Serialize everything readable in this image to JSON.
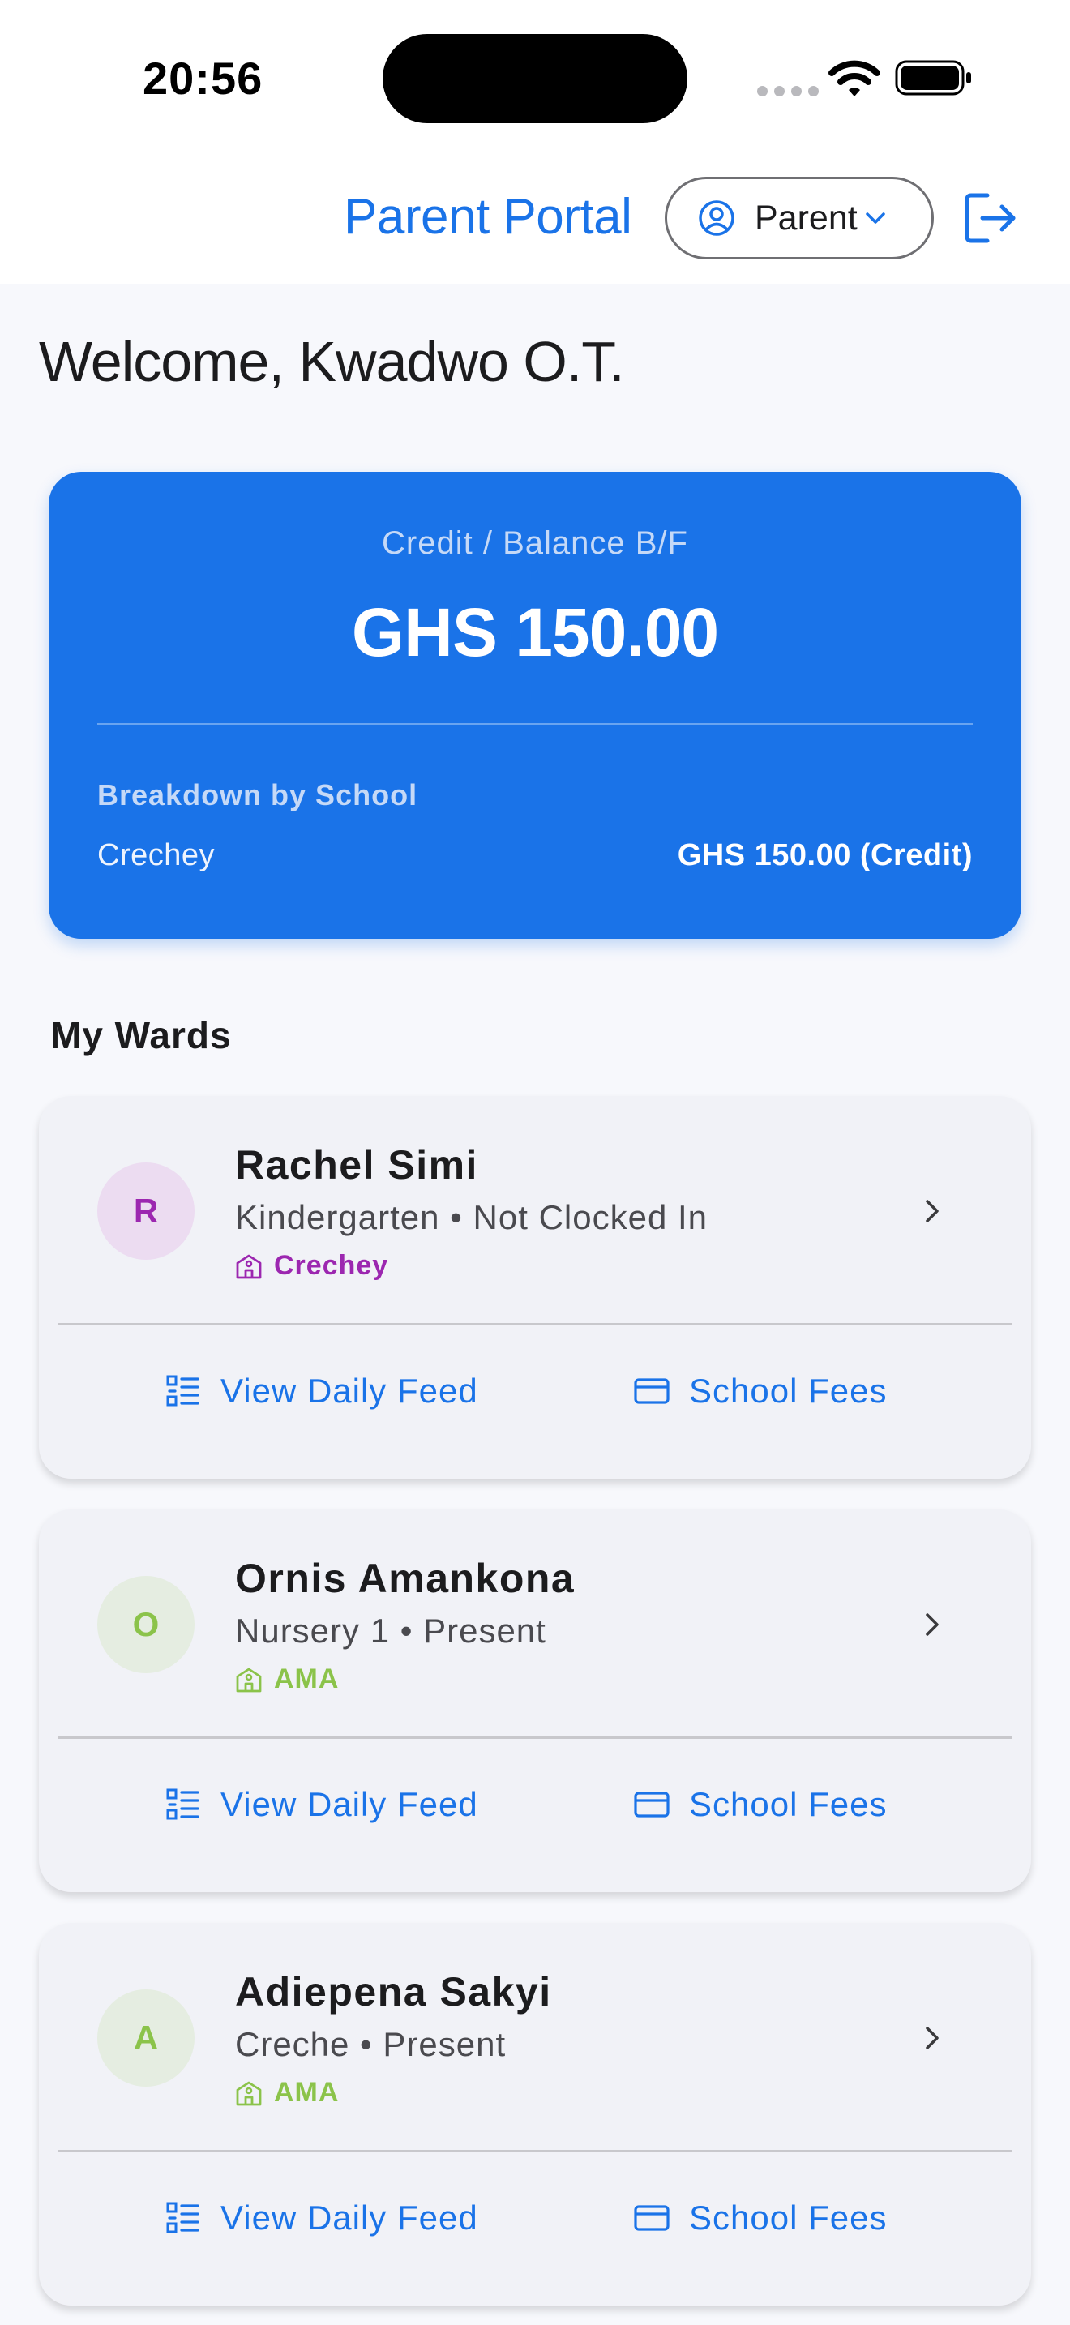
{
  "status_bar": {
    "time": "20:56"
  },
  "header": {
    "title": "Parent Portal",
    "role_label": "Parent"
  },
  "welcome": "Welcome, Kwadwo O.T.",
  "balance": {
    "label": "Credit / Balance B/F",
    "amount": "GHS 150.00",
    "breakdown_title": "Breakdown by School",
    "breakdown": [
      {
        "school": "Crechey",
        "amount": "GHS 150.00 (Credit)"
      }
    ]
  },
  "wards_section": {
    "title": "My Wards"
  },
  "wards": [
    {
      "initial": "R",
      "name": "Rachel Simi",
      "subtitle": "Kindergarten • Not Clocked In",
      "school": "Crechey",
      "accent": "#9c27b0",
      "avatar_bg": "#ecdcf1",
      "feed_label": "View Daily Feed",
      "fees_label": "School Fees"
    },
    {
      "initial": "O",
      "name": "Ornis Amankona",
      "subtitle": "Nursery 1 • Present",
      "school": "AMA",
      "accent": "#8bc34a",
      "avatar_bg": "#e5ede1",
      "feed_label": "View Daily Feed",
      "fees_label": "School Fees"
    },
    {
      "initial": "A",
      "name": "Adiepena Sakyi",
      "subtitle": "Creche • Present",
      "school": "AMA",
      "accent": "#8bc34a",
      "avatar_bg": "#e5ede1",
      "feed_label": "View Daily Feed",
      "fees_label": "School Fees"
    }
  ],
  "icons": {
    "role": "user-circle-icon",
    "dropdown": "chevron-down-icon",
    "logout": "logout-icon",
    "school": "school-building-icon",
    "ward_open": "chevron-right-icon",
    "feed": "list-icon",
    "fees": "credit-card-icon"
  },
  "colors": {
    "primary": "#1a73e8",
    "background": "#f7f8fc",
    "card": "#f1f2f7"
  }
}
